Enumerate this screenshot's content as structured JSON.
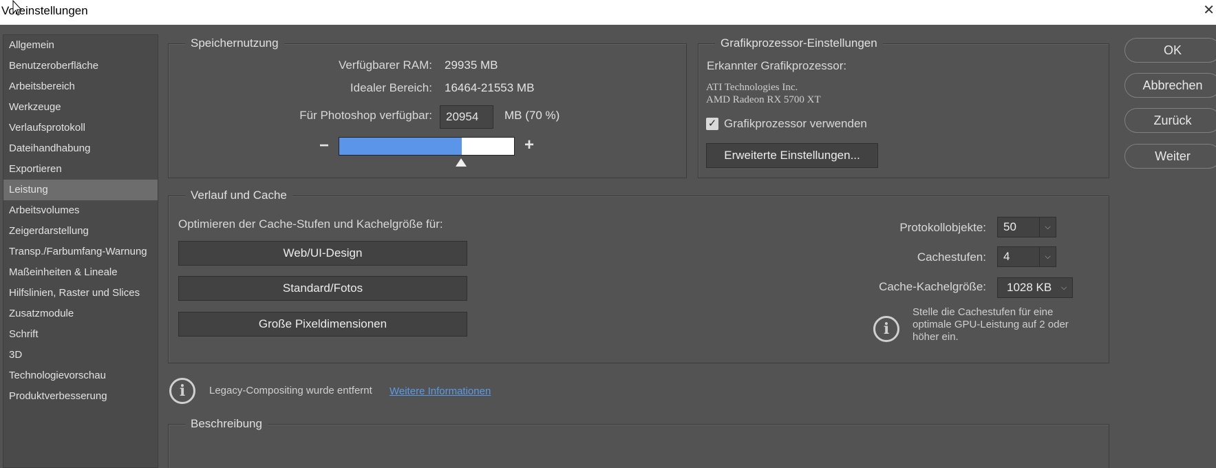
{
  "window": {
    "title": "Voreinstellungen",
    "close_glyph": "✕"
  },
  "sidebar": {
    "items": [
      {
        "label": "Allgemein"
      },
      {
        "label": "Benutzeroberfläche"
      },
      {
        "label": "Arbeitsbereich"
      },
      {
        "label": "Werkzeuge"
      },
      {
        "label": "Verlaufsprotokoll"
      },
      {
        "label": "Dateihandhabung"
      },
      {
        "label": "Exportieren"
      },
      {
        "label": "Leistung"
      },
      {
        "label": "Arbeitsvolumes"
      },
      {
        "label": "Zeigerdarstellung"
      },
      {
        "label": "Transp./Farbumfang-Warnung"
      },
      {
        "label": "Maßeinheiten & Lineale"
      },
      {
        "label": "Hilfslinien, Raster und Slices"
      },
      {
        "label": "Zusatzmodule"
      },
      {
        "label": "Schrift"
      },
      {
        "label": "3D"
      },
      {
        "label": "Technologievorschau"
      },
      {
        "label": "Produktverbesserung"
      }
    ],
    "active_index": 7
  },
  "memory": {
    "legend": "Speichernutzung",
    "ram_label": "Verfügbarer RAM:",
    "ram_value": "29935 MB",
    "range_label": "Idealer Bereich:",
    "range_value": "16464-21553 MB",
    "ps_label": "Für Photoshop verfügbar:",
    "ps_input": "20954",
    "ps_unit": "MB (70 %)",
    "minus": "−",
    "plus": "+",
    "slider_percent": 70
  },
  "gpu": {
    "legend": "Grafikprozessor-Einstellungen",
    "detected_label": "Erkannter Grafikprozessor:",
    "vendor": "ATI Technologies Inc.",
    "model": "AMD Radeon RX 5700 XT",
    "use_gpu_label": "Grafikprozessor verwenden",
    "use_gpu_checked": true,
    "advanced_button": "Erweiterte Einstellungen..."
  },
  "cache": {
    "legend": "Verlauf und Cache",
    "optimize_label": "Optimieren der Cache-Stufen und Kachelgröße für:",
    "buttons": [
      "Web/UI-Design",
      "Standard/Fotos",
      "Große Pixeldimensionen"
    ],
    "history_label": "Protokollobjekte:",
    "history_value": "50",
    "levels_label": "Cachestufen:",
    "levels_value": "4",
    "tile_label": "Cache-Kachelgröße:",
    "tile_value": "1028 KB",
    "info_text_1": "Stelle die Cachestufen für eine",
    "info_text_2": "optimale GPU-Leistung auf 2 oder",
    "info_text_3": "höher ein."
  },
  "legacy": {
    "text": "Legacy-Compositing wurde entfernt",
    "link": "Weitere Informationen"
  },
  "description": {
    "legend": "Beschreibung"
  },
  "actions": {
    "ok": "OK",
    "cancel": "Abbrechen",
    "back": "Zurück",
    "next": "Weiter"
  },
  "icons": {
    "info": "i",
    "caret": "⌵",
    "check": "✓"
  }
}
